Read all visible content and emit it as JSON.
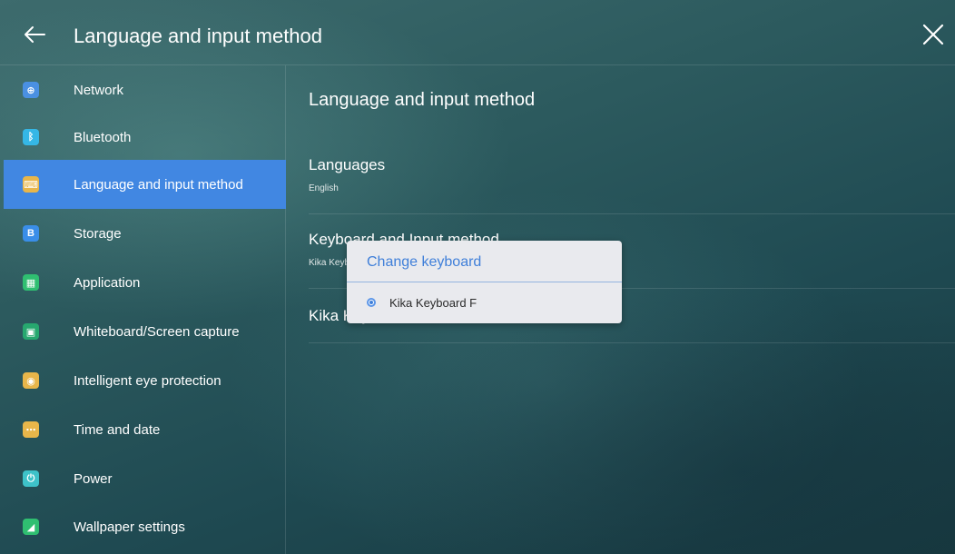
{
  "header": {
    "title": "Language and input method"
  },
  "sidebar": {
    "items": [
      {
        "label": "Network",
        "icon": "globe-icon",
        "color": "#4a90e2",
        "glyph": "⊕",
        "active": false
      },
      {
        "label": "Bluetooth",
        "icon": "bluetooth-icon",
        "color": "#35b7e6",
        "glyph": "ᛒ",
        "active": false
      },
      {
        "label": "Language and input method",
        "icon": "keyboard-icon",
        "color": "#e8b64a",
        "glyph": "⌨",
        "active": true
      },
      {
        "label": "Storage",
        "icon": "storage-icon",
        "color": "#3a8ee8",
        "glyph": "B",
        "active": false
      },
      {
        "label": "Application",
        "icon": "apps-icon",
        "color": "#2fbf71",
        "glyph": "▦",
        "active": false
      },
      {
        "label": "Whiteboard/Screen capture",
        "icon": "screen-capture-icon",
        "color": "#27a86f",
        "glyph": "▣",
        "active": false
      },
      {
        "label": "Intelligent eye protection",
        "icon": "eye-icon",
        "color": "#e8b64a",
        "glyph": "◉",
        "active": false
      },
      {
        "label": "Time and date",
        "icon": "calendar-icon",
        "color": "#e8b64a",
        "glyph": "⋯",
        "active": false
      },
      {
        "label": "Power",
        "icon": "power-icon",
        "color": "#3ec2c9",
        "glyph": "⏻",
        "active": false
      },
      {
        "label": "Wallpaper settings",
        "icon": "wallpaper-icon",
        "color": "#2fbf71",
        "glyph": "◢",
        "active": false
      }
    ]
  },
  "content": {
    "title": "Language and input method",
    "rows": [
      {
        "main": "Languages",
        "sub": "English"
      },
      {
        "main": "Keyboard and Input method",
        "sub": "Kika Keyboard F"
      },
      {
        "main": "Kika Keyboard F",
        "sub": ""
      }
    ]
  },
  "dialog": {
    "title": "Change keyboard",
    "options": [
      {
        "label": "Kika Keyboard F",
        "selected": true
      }
    ]
  },
  "colors": {
    "accent": "#4187e2",
    "dialog_title": "#3f7fd9",
    "dialog_bg": "#e9eaee"
  }
}
